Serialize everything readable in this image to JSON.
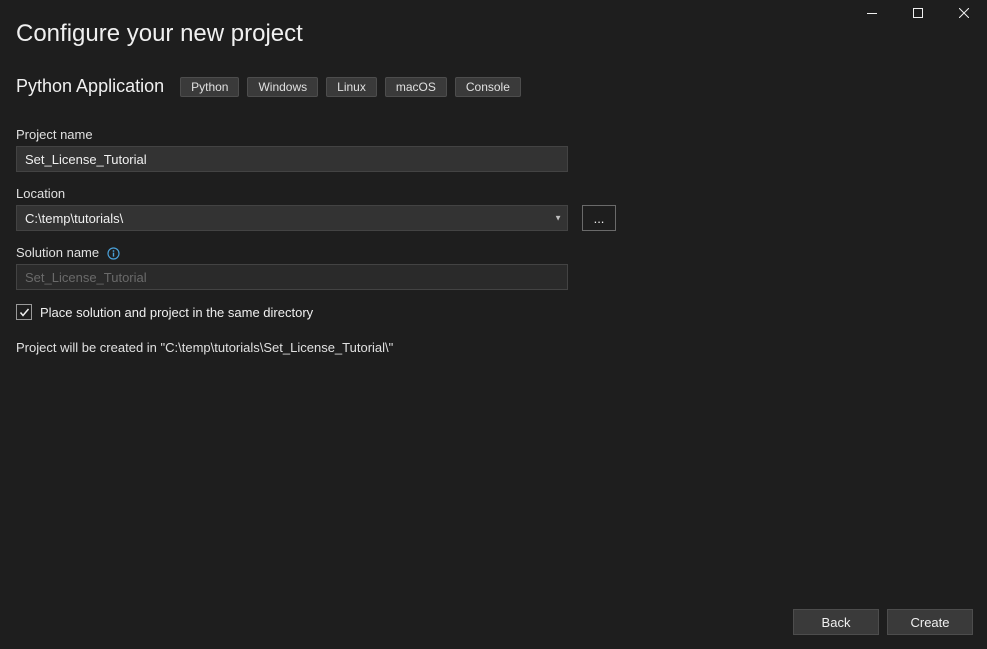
{
  "header": {
    "title": "Configure your new project"
  },
  "template": {
    "name": "Python Application",
    "tags": [
      "Python",
      "Windows",
      "Linux",
      "macOS",
      "Console"
    ]
  },
  "form": {
    "project_name": {
      "label": "Project name",
      "value": "Set_License_Tutorial"
    },
    "location": {
      "label": "Location",
      "value": "C:\\temp\\tutorials\\",
      "browse_label": "..."
    },
    "solution_name": {
      "label": "Solution name",
      "placeholder": "Set_License_Tutorial"
    },
    "same_directory": {
      "label": "Place solution and project in the same directory",
      "checked": true
    },
    "summary": "Project will be created in \"C:\\temp\\tutorials\\Set_License_Tutorial\\\""
  },
  "footer": {
    "back_label": "Back",
    "create_label": "Create"
  }
}
